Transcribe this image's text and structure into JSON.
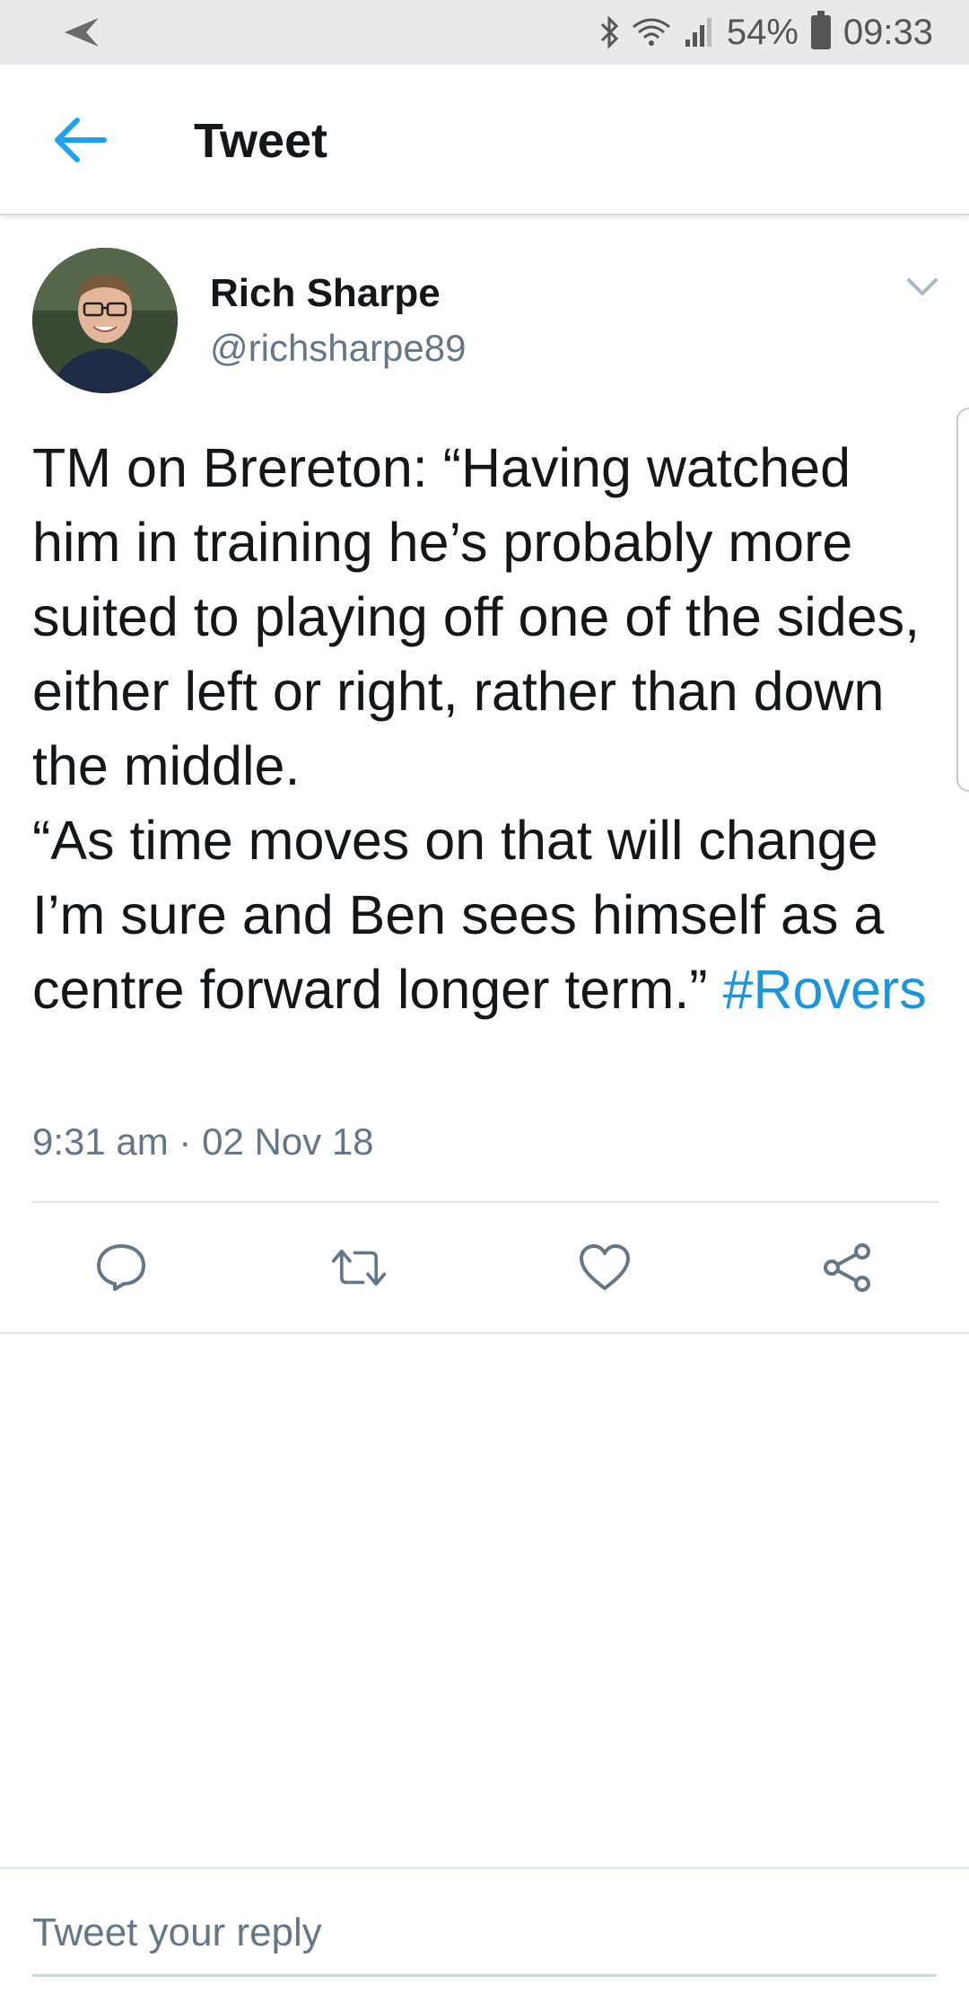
{
  "status_bar": {
    "battery_percent": "54%",
    "time": "09:33",
    "icons": [
      "back-arrow-icon",
      "bluetooth-icon",
      "wifi-icon",
      "signal-icon",
      "battery-icon"
    ]
  },
  "header": {
    "title": "Tweet",
    "back_icon": "arrow-left-icon",
    "accent_color": "#1da1f2"
  },
  "tweet": {
    "author_name": "Rich Sharpe",
    "author_handle": "@richsharpe89",
    "text_main": "TM on Brereton: “Having watched him in training he’s probably more suited to playing off one of the sides, either left or right, rather than down the middle.\n“As time moves on that will change I’m sure and Ben sees himself as a centre forward longer term.” ",
    "hashtag": "#Rovers",
    "timestamp": "9:31 am · 02 Nov 18",
    "actions": [
      "reply-icon",
      "retweet-icon",
      "like-icon",
      "share-icon"
    ]
  },
  "reply": {
    "placeholder": "Tweet your reply"
  }
}
